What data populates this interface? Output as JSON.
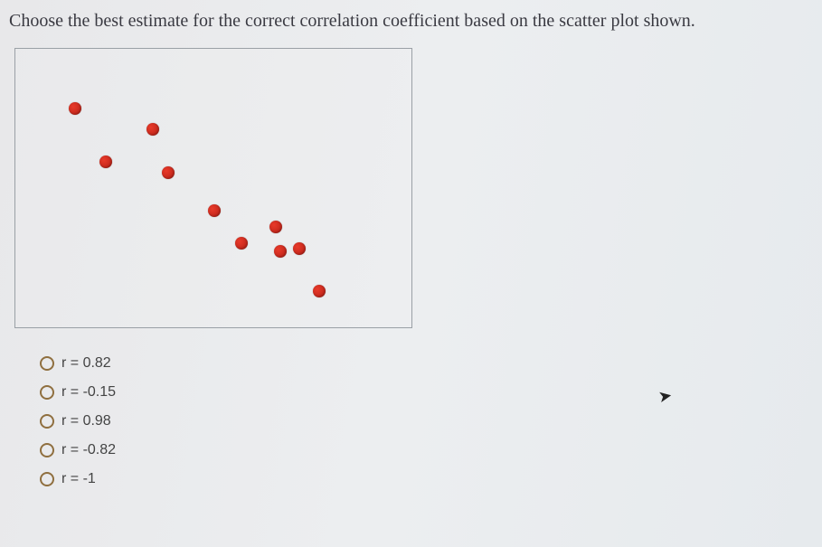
{
  "question": "Choose the best estimate for the correct correlation coefficient based on the scatter plot shown.",
  "chart_data": {
    "type": "scatter",
    "title": "",
    "xlabel": "",
    "ylabel": "",
    "xlim": [
      0,
      100
    ],
    "ylim": [
      0,
      100
    ],
    "series": [
      {
        "name": "points",
        "x": [
          14,
          22,
          34,
          38,
          50,
          57,
          66,
          67,
          72,
          77
        ],
        "y": [
          80,
          60,
          72,
          56,
          42,
          30,
          36,
          27,
          28,
          12
        ]
      }
    ]
  },
  "options": [
    {
      "label": "r = 0.82"
    },
    {
      "label": "r = -0.15"
    },
    {
      "label": "r = 0.98"
    },
    {
      "label": "r = -0.82"
    },
    {
      "label": "r = -1"
    }
  ]
}
